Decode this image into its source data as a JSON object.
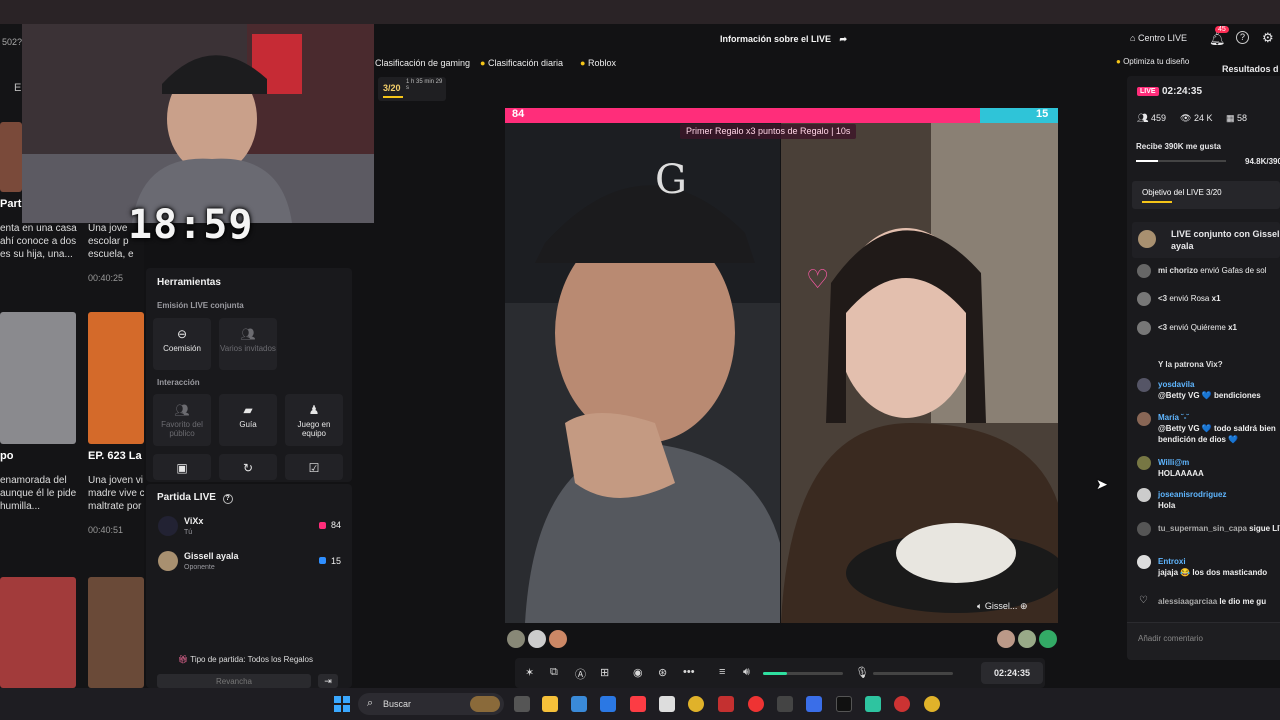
{
  "header": {
    "chips": [
      "Clasificación de gaming",
      "Clasificación diaria",
      "Roblox"
    ],
    "progress": "3/20",
    "progress_timer": "1 h 35 min 29 s",
    "live_info": "Información sobre el LIVE",
    "centro_live": "Centro LIVE",
    "notif_count": "45",
    "optimize": "Optimiza tu diseño",
    "results": "Resultados d"
  },
  "left_strip": {
    "tab_letter": "E",
    "num": "502?",
    "card1_title": "Part",
    "card1_text": "enta en una casa\nahí conoce a dos\nes su hija, una...",
    "card2_text": "Una jove\nescolar p\nescuela, e",
    "card2_time": "00:40:25",
    "card3_title": "po",
    "card3_text": "enamorada del\naunque él le pide\nhumilla...",
    "card4_title": "EP. 623  La",
    "card4_text": "Una joven vi\nmadre vive c\nmaltrate por",
    "card4_time": "00:40:51"
  },
  "overlay": {
    "timer": "18:59"
  },
  "tools": {
    "title": "Herramientas",
    "sect1": "Emisión LIVE conjunta",
    "cohost": "Coemisión",
    "guests": "Varios invitados",
    "sect2": "Interacción",
    "fav": "Favorito del público",
    "guide": "Guía",
    "team_game": "Juego en equipo"
  },
  "partida": {
    "title": "Partida LIVE",
    "p1_name": "ViXx",
    "p1_sub": "Tú",
    "p1_score": "84",
    "p2_name": "Gissell ayala",
    "p2_sub": "Oponente",
    "p2_score": "15",
    "type": "Tipo de partida: Todos los Regalos",
    "rematch": "Revancha"
  },
  "battle": {
    "left_score": "84",
    "right_score": "15",
    "promo": "Primer Regalo x3 puntos de Regalo | 10s",
    "right_name": "Gissel..."
  },
  "controls": {
    "time": "02:24:35"
  },
  "chat": {
    "live_badge": "LIVE",
    "elapsed": "02:24:35",
    "viewers": "459",
    "views": "24 K",
    "gifts": "58",
    "goal_text": "Recibe 390K me gusta",
    "goal_value": "94.8K/390K",
    "goal_fraction": 0.243,
    "objective": "Objetivo del LIVE 3/20",
    "conjunto": "LIVE conjunto con Gissell ayala",
    "msgs": [
      {
        "u": "mi chorizo",
        "t": "envió Gafas de sol"
      },
      {
        "u": "<3",
        "t": "envió Rosa"
      },
      {
        "u": "<3",
        "t": "envió Quiéreme"
      },
      {
        "u": "",
        "t": "Y la patrona Vix?"
      },
      {
        "u": "yosdavila",
        "t": "@Betty VG 💙  bendiciones"
      },
      {
        "u": "María ˘-˘",
        "t": "@Betty VG 💙  todo saldrá bien bendición de dios 💙"
      },
      {
        "u": "Willi@m",
        "t": "HOLAAAAA"
      },
      {
        "u": "joseanisrodriguez",
        "t": "Hola"
      },
      {
        "u": "tu_superman_sin_capa",
        "t": "sigue LIVE"
      },
      {
        "u": "Entroxi",
        "t": "jajaja 😂 los dos masticando"
      },
      {
        "u": "alessiaagarciaa",
        "t": "le dio me gu"
      }
    ],
    "gift_x1": "x1",
    "placeholder": "Añadir comentario"
  },
  "taskbar": {
    "search": "Buscar"
  }
}
